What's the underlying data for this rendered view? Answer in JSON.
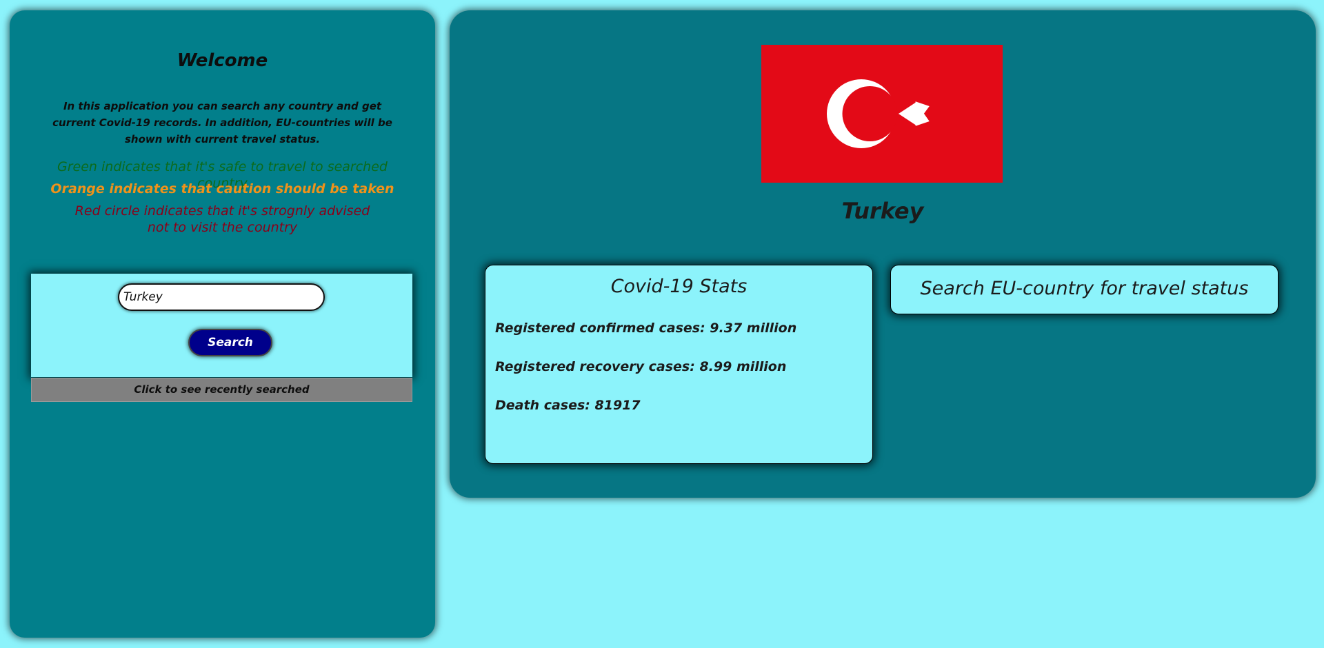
{
  "sidebar": {
    "title": "Welcome",
    "intro": "In this application you can search any country and get current Covid-19 records. In addition, EU-countries will be shown with current travel status.",
    "legend": {
      "green": "Green indicates that it's safe to travel to searched country",
      "orange": "Orange indicates that caution should be taken",
      "red": "Red circle indicates that it's strognly advised not to visit the country"
    },
    "search": {
      "input_value": "Turkey",
      "button_label": "Search",
      "recent_label": "Click to see recently searched"
    }
  },
  "main": {
    "flag_icon": "turkey-flag-icon",
    "country": "Turkey",
    "stats": {
      "title": "Covid-19 Stats",
      "confirmed": "Registered confirmed cases: 9.37 million",
      "recovered": "Registered recovery cases: 8.99 million",
      "deaths": "Death cases: 81917"
    },
    "eu_travel_label": "Search EU-country for travel status"
  },
  "colors": {
    "background": "#8cf3fb",
    "left_panel": "#027f8b",
    "right_panel": "#067684",
    "button": "#00008b",
    "green": "#0b6b1c",
    "orange": "#f0921a",
    "red": "#8b0018",
    "flag_red": "#e30a17"
  }
}
